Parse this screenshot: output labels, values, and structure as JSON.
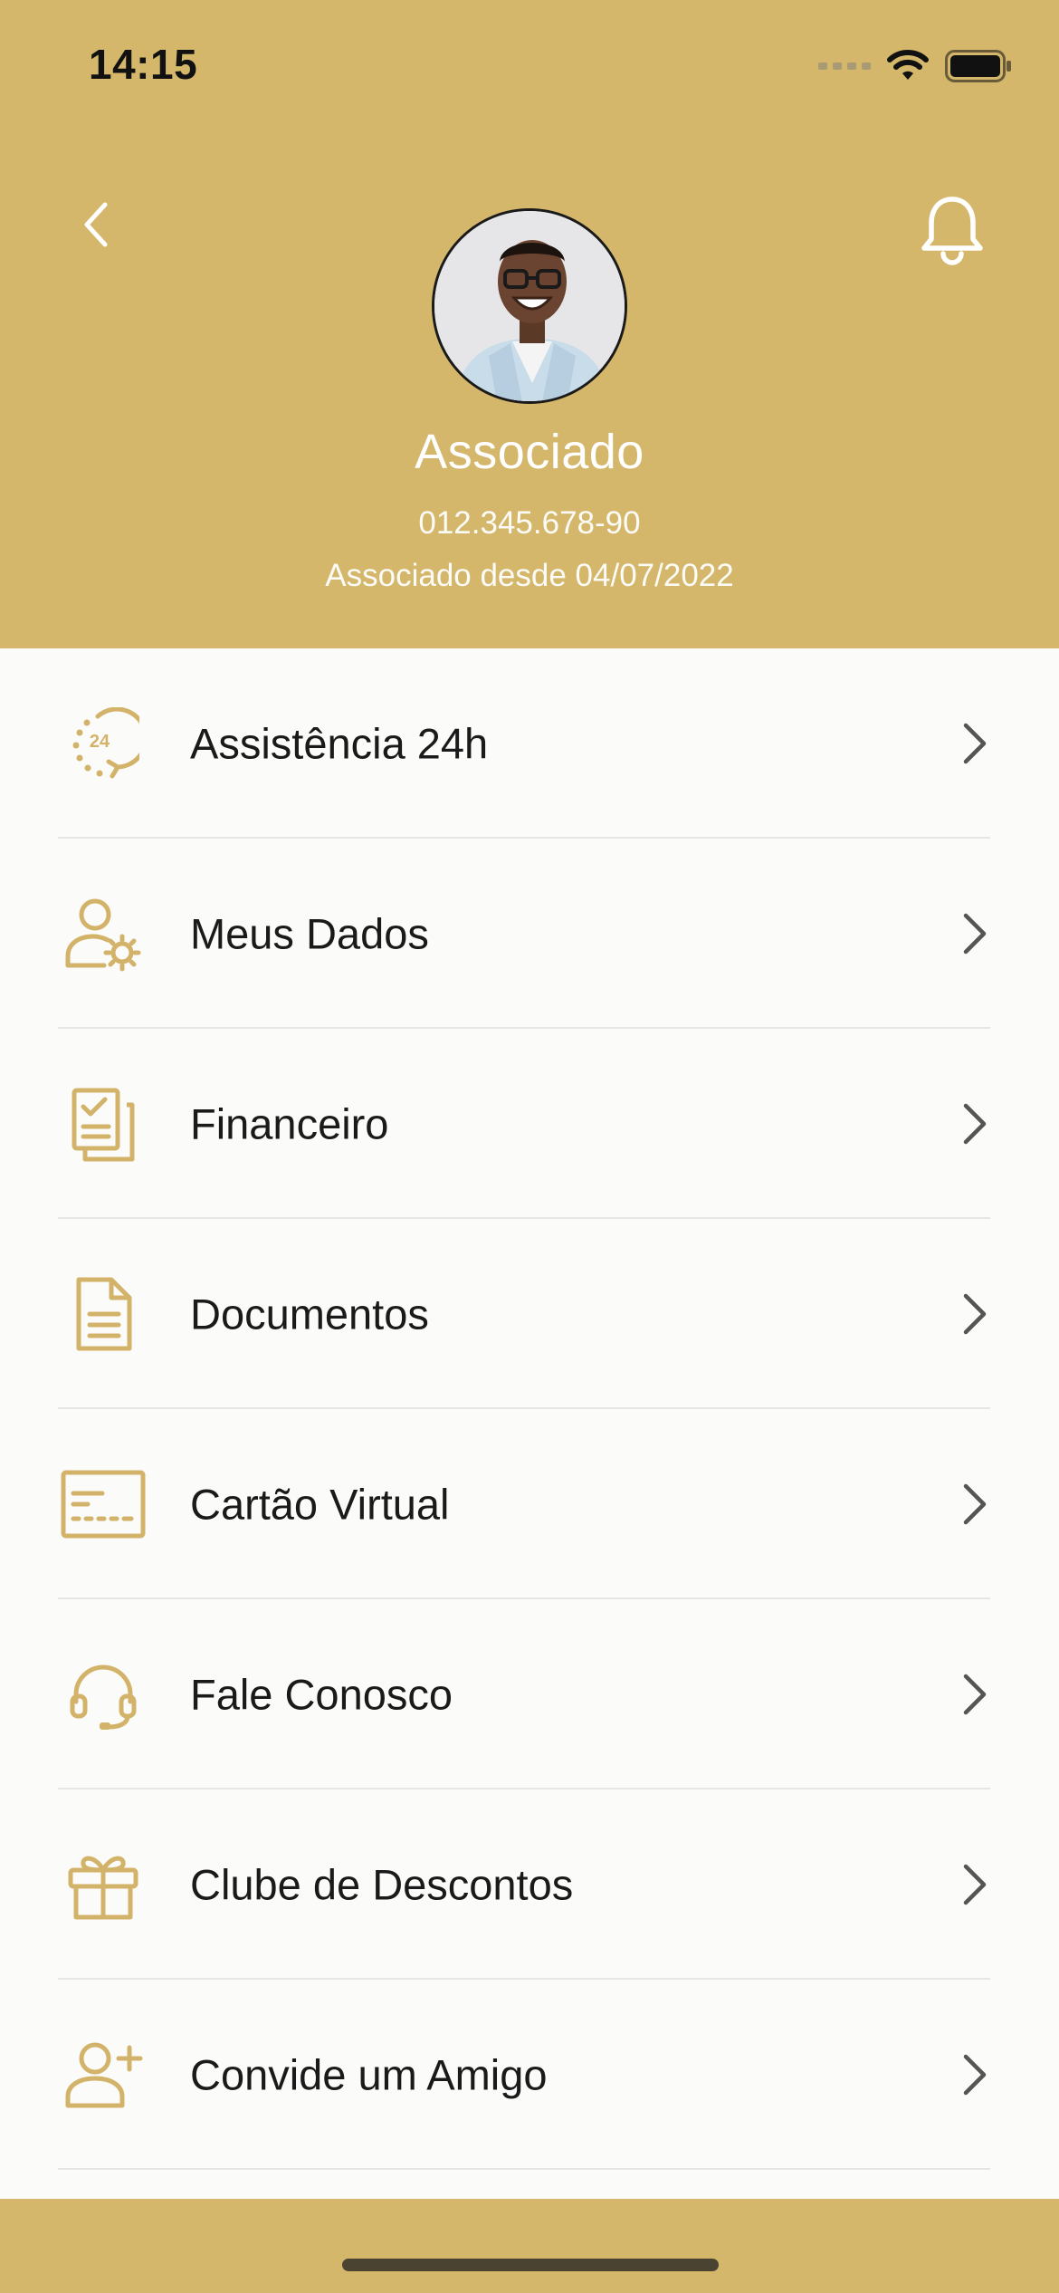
{
  "status_bar": {
    "time": "14:15"
  },
  "header": {
    "back_icon": "chevron-left-icon",
    "notification_icon": "bell-icon",
    "profile": {
      "name": "Associado",
      "cpf": "012.345.678-90",
      "member_since": "Associado desde 04/07/2022"
    }
  },
  "menu": {
    "items": [
      {
        "label": "Assistência 24h",
        "icon": "assistance-24h-icon"
      },
      {
        "label": "Meus Dados",
        "icon": "user-settings-icon"
      },
      {
        "label": "Financeiro",
        "icon": "financial-documents-icon"
      },
      {
        "label": "Documentos",
        "icon": "document-icon"
      },
      {
        "label": "Cartão Virtual",
        "icon": "card-icon"
      },
      {
        "label": "Fale Conosco",
        "icon": "headset-icon"
      },
      {
        "label": "Clube de Descontos",
        "icon": "gift-icon"
      },
      {
        "label": "Convide um Amigo",
        "icon": "add-user-icon"
      }
    ]
  },
  "colors": {
    "brand_gold": "#d4b76b",
    "icon_gold": "#d3b36a",
    "text_dark": "#1a1a1a",
    "chevron": "#555555"
  }
}
